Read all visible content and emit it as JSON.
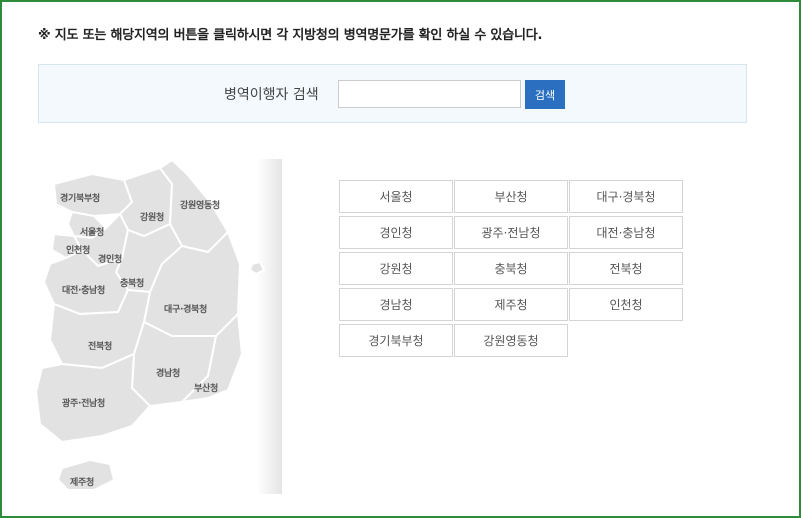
{
  "notice": "※ 지도 또는 해당지역의 버튼을 클릭하시면 각 지방청의 병역명문가를 확인 하실 수 있습니다.",
  "search": {
    "label": "병역이행자 검색",
    "value": "",
    "button_label": "검색"
  },
  "map": {
    "labels": [
      {
        "id": "gyeonggi-north",
        "text": "경기북부청"
      },
      {
        "id": "gangwon-yeongdong",
        "text": "강원영동청"
      },
      {
        "id": "gangwon",
        "text": "강원청"
      },
      {
        "id": "seoul",
        "text": "서울청"
      },
      {
        "id": "incheon",
        "text": "인천청"
      },
      {
        "id": "gyeongin",
        "text": "경인청"
      },
      {
        "id": "chungbuk",
        "text": "충북청"
      },
      {
        "id": "daejeon-chungnam",
        "text": "대전·충남청"
      },
      {
        "id": "daegu-gyeongbuk",
        "text": "대구·경북청"
      },
      {
        "id": "jeonbuk",
        "text": "전북청"
      },
      {
        "id": "gyeongnam",
        "text": "경남청"
      },
      {
        "id": "busan",
        "text": "부산청"
      },
      {
        "id": "gwangju-jeonnam",
        "text": "광주·전남청"
      },
      {
        "id": "jeju",
        "text": "제주청"
      }
    ],
    "fill_color": "#e2e2e2",
    "border_color": "#ffffff"
  },
  "offices": [
    "서울청",
    "부산청",
    "대구·경북청",
    "경인청",
    "광주·전남청",
    "대전·충남청",
    "강원청",
    "충북청",
    "전북청",
    "경남청",
    "제주청",
    "인천청",
    "경기북부청",
    "강원영동청"
  ],
  "colors": {
    "frame_border": "#2e8b3a",
    "search_bg": "#f3f9fc",
    "button_bg": "#2a6fc0"
  }
}
